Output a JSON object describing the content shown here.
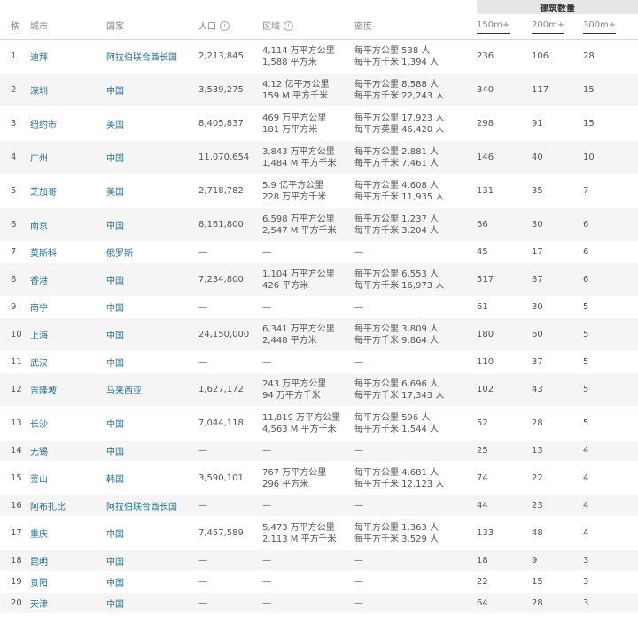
{
  "table": {
    "group_header": "建筑数量",
    "headers": {
      "rank": "秩",
      "city": "城市",
      "country": "国家",
      "population": "人口",
      "area": "区域",
      "density": "密度",
      "b150": "150m+",
      "b200": "200m+",
      "b300": "300m+"
    },
    "rows": [
      {
        "rank": "1",
        "city": "迪拜",
        "country": "阿拉伯联合酋长国",
        "population": "2,213,845",
        "area": [
          "4,114 万平方公里",
          "1,588 平方米"
        ],
        "density": [
          "每平方公里 538 人",
          "每平方千米 1,394 人"
        ],
        "b150": "236",
        "b200": "106",
        "b300": "28"
      },
      {
        "rank": "2",
        "city": "深圳",
        "country": "中国",
        "population": "3,539,275",
        "area": [
          "4.12 亿平方公里",
          "159 M 平方千米"
        ],
        "density": [
          "每平方公里 8,588 人",
          "每平方千米 22,243 人"
        ],
        "b150": "340",
        "b200": "117",
        "b300": "15"
      },
      {
        "rank": "3",
        "city": "纽约市",
        "country": "美国",
        "population": "8,405,837",
        "area": [
          "469 万平方公里",
          "181 万平方米"
        ],
        "density": [
          "每平方公里 17,923 人",
          "每平方英里 46,420 人"
        ],
        "b150": "298",
        "b200": "91",
        "b300": "15"
      },
      {
        "rank": "4",
        "city": "广州",
        "country": "中国",
        "population": "11,070,654",
        "area": [
          "3,843 万平方公里",
          "1,484 M 平方千米"
        ],
        "density": [
          "每平方公里 2,881 人",
          "每平方千米 7,461 人"
        ],
        "b150": "146",
        "b200": "40",
        "b300": "10"
      },
      {
        "rank": "5",
        "city": "芝加哥",
        "country": "美国",
        "population": "2,718,782",
        "area": [
          "5.9 亿平方公里",
          "228 万平方千米"
        ],
        "density": [
          "每平方公里 4,608 人",
          "每平方千米 11,935 人"
        ],
        "b150": "131",
        "b200": "35",
        "b300": "7"
      },
      {
        "rank": "6",
        "city": "南京",
        "country": "中国",
        "population": "8,161,800",
        "area": [
          "6,598 万平方公里",
          "2,547 M 平方千米"
        ],
        "density": [
          "每平方公里 1,237 人",
          "每平方千米 3,204 人"
        ],
        "b150": "66",
        "b200": "30",
        "b300": "6"
      },
      {
        "rank": "7",
        "city": "莫斯科",
        "country": "俄罗斯",
        "population": "—",
        "area": [
          "—"
        ],
        "density": [
          "—"
        ],
        "b150": "45",
        "b200": "17",
        "b300": "6"
      },
      {
        "rank": "8",
        "city": "香港",
        "country": "中国",
        "population": "7,234,800",
        "area": [
          "1,104 万平方公里",
          "426 平方米"
        ],
        "density": [
          "每平方公里 6,553 人",
          "每平方千米 16,973 人"
        ],
        "b150": "517",
        "b200": "87",
        "b300": "6"
      },
      {
        "rank": "9",
        "city": "南宁",
        "country": "中国",
        "population": "—",
        "area": [
          "—"
        ],
        "density": [
          "—"
        ],
        "b150": "61",
        "b200": "30",
        "b300": "5"
      },
      {
        "rank": "10",
        "city": "上海",
        "country": "中国",
        "population": "24,150,000",
        "area": [
          "6,341 万平方公里",
          "2,448 平方米"
        ],
        "density": [
          "每平方公里 3,809 人",
          "每平方千米 9,864 人"
        ],
        "b150": "180",
        "b200": "60",
        "b300": "5"
      },
      {
        "rank": "11",
        "city": "武汉",
        "country": "中国",
        "population": "—",
        "area": [
          "—"
        ],
        "density": [
          "—"
        ],
        "b150": "110",
        "b200": "37",
        "b300": "5"
      },
      {
        "rank": "12",
        "city": "吉隆坡",
        "country": "马来西亚",
        "population": "1,627,172",
        "area": [
          "243 万平方公里",
          "94 万平方千米"
        ],
        "density": [
          "每平方公里 6,696 人",
          "每平方千米 17,343 人"
        ],
        "b150": "102",
        "b200": "43",
        "b300": "5"
      },
      {
        "rank": "13",
        "city": "长沙",
        "country": "中国",
        "population": "7,044,118",
        "area": [
          "11,819 万平方公里",
          "4,563 M 平方千米"
        ],
        "density": [
          "每平方公里 596 人",
          "每平方千米 1,544 人"
        ],
        "b150": "52",
        "b200": "28",
        "b300": "5"
      },
      {
        "rank": "14",
        "city": "无锡",
        "country": "中国",
        "population": "—",
        "area": [
          "—"
        ],
        "density": [
          "—"
        ],
        "b150": "25",
        "b200": "13",
        "b300": "4"
      },
      {
        "rank": "15",
        "city": "釜山",
        "country": "韩国",
        "population": "3,590,101",
        "area": [
          "767 万平方公里",
          "296 平方米"
        ],
        "density": [
          "每平方公里 4,681 人",
          "每平方千米 12,123 人"
        ],
        "b150": "74",
        "b200": "22",
        "b300": "4"
      },
      {
        "rank": "16",
        "city": "阿布扎比",
        "country": "阿拉伯联合酋长国",
        "population": "—",
        "area": [
          "—"
        ],
        "density": [
          "—"
        ],
        "b150": "44",
        "b200": "23",
        "b300": "4"
      },
      {
        "rank": "17",
        "city": "重庆",
        "country": "中国",
        "population": "7,457,589",
        "area": [
          "5,473 万平方公里",
          "2,113 M 平方千米"
        ],
        "density": [
          "每平方公里 1,363 人",
          "每平方千米 3,529 人"
        ],
        "b150": "133",
        "b200": "48",
        "b300": "4"
      },
      {
        "rank": "18",
        "city": "昆明",
        "country": "中国",
        "population": "—",
        "area": [
          "—"
        ],
        "density": [
          "—"
        ],
        "b150": "18",
        "b200": "9",
        "b300": "3"
      },
      {
        "rank": "19",
        "city": "贵阳",
        "country": "中国",
        "population": "—",
        "area": [
          "—"
        ],
        "density": [
          "—"
        ],
        "b150": "22",
        "b200": "15",
        "b300": "3"
      },
      {
        "rank": "20",
        "city": "天津",
        "country": "中国",
        "population": "—",
        "area": [
          "—"
        ],
        "density": [
          "—"
        ],
        "b150": "64",
        "b200": "28",
        "b300": "3"
      }
    ]
  },
  "colors": {
    "link": "#2a6f93",
    "stripe": "#f5f5f5",
    "group_header_bg": "#e6e6e6"
  }
}
